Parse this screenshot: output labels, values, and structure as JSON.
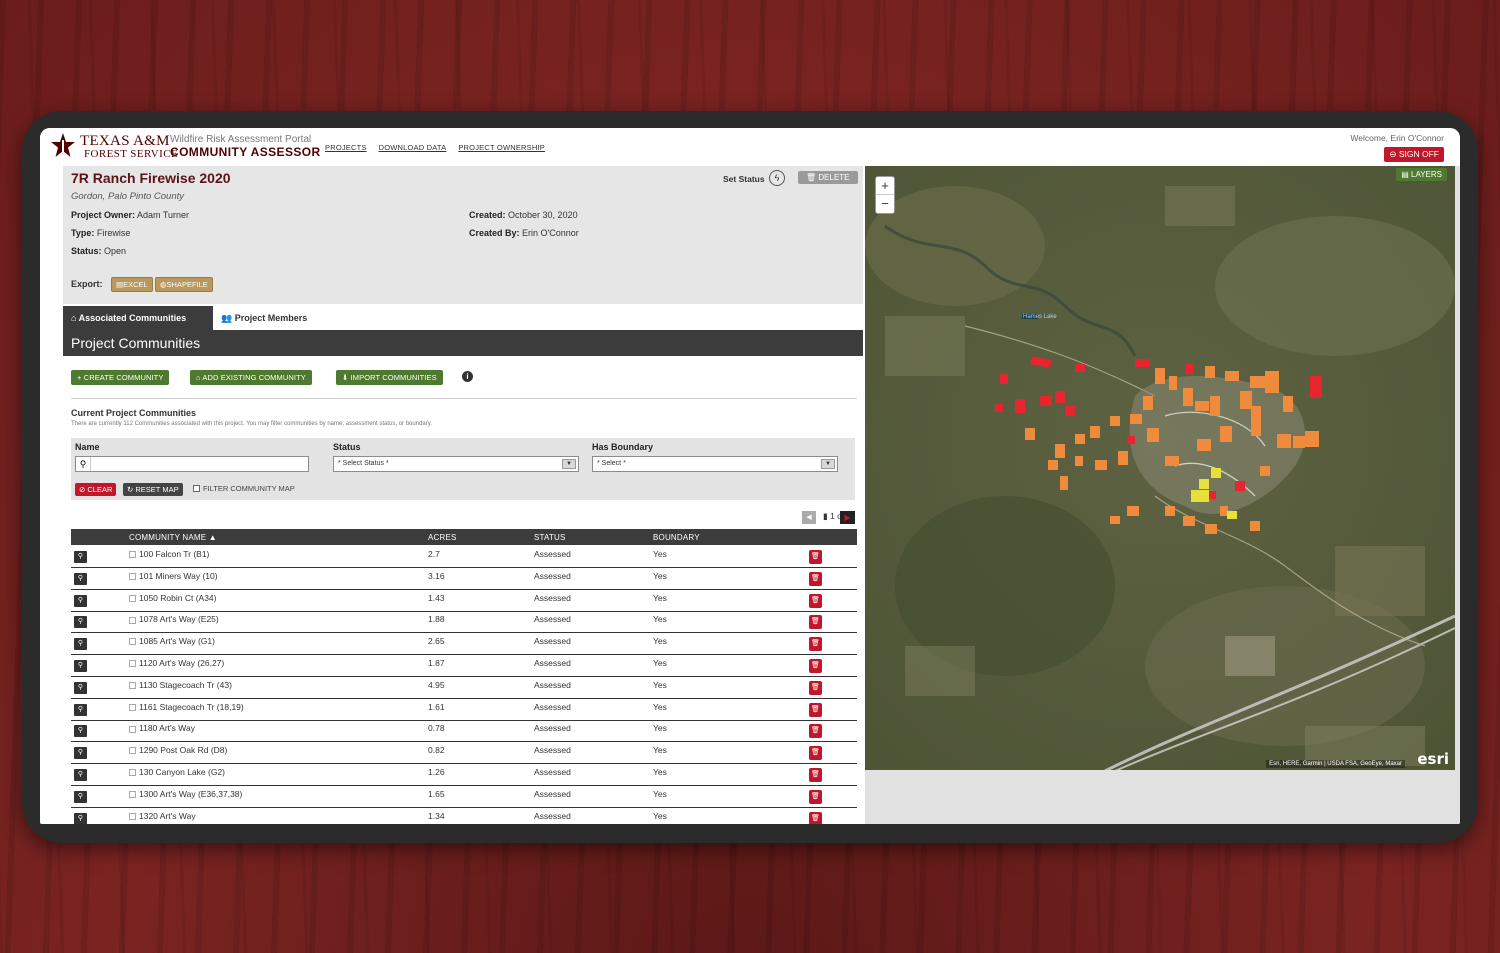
{
  "header": {
    "logo_title": "TEXAS A&M",
    "logo_sub": "FOREST SERVICE",
    "portal_sub": "Wildfire Risk Assessment Portal",
    "portal_title": "COMMUNITY ASSESSOR",
    "nav": [
      "PROJECTS",
      "DOWNLOAD DATA",
      "PROJECT OWNERSHIP"
    ],
    "welcome": "Welcome, Erin O'Connor",
    "sign_off": "SIGN OFF"
  },
  "project": {
    "title": "7R Ranch Firewise 2020",
    "location": "Gordon, Palo Pinto County",
    "owner_label": "Project Owner:",
    "owner": "Adam Turner",
    "type_label": "Type:",
    "type": "Firewise",
    "status_label": "Status:",
    "status": "Open",
    "created_label": "Created:",
    "created": "October 30, 2020",
    "created_by_label": "Created By:",
    "created_by": "Erin O'Connor",
    "set_status": "Set Status",
    "delete": "DELETE",
    "export_label": "Export:",
    "export_excel": "EXCEL",
    "export_shapefile": "SHAPEFILE"
  },
  "tabs": [
    "Associated Communities",
    "Project Members"
  ],
  "section_title": "Project Communities",
  "actions": [
    "CREATE COMMUNITY",
    "ADD EXISTING COMMUNITY",
    "IMPORT COMMUNITIES"
  ],
  "current": {
    "title": "Current Project Communities",
    "desc": "There are currently 112 Communities associated with this project. You may filter communities by name, assessment status, or boundary."
  },
  "filters": {
    "name_label": "Name",
    "name_value": "",
    "status_label": "Status",
    "status_value": "* Select Status *",
    "boundary_label": "Has Boundary",
    "boundary_value": "* Select *",
    "clear": "CLEAR",
    "reset_map": "RESET MAP",
    "filter_map": "FILTER COMMUNITY MAP"
  },
  "pager": {
    "text": "1 of 6"
  },
  "table": {
    "headers": [
      "COMMUNITY NAME",
      "ACRES",
      "STATUS",
      "BOUNDARY"
    ],
    "rows": [
      {
        "name": "100 Falcon Tr (B1)",
        "acres": "2.7",
        "status": "Assessed",
        "boundary": "Yes"
      },
      {
        "name": "101 Miners Way (10)",
        "acres": "3.16",
        "status": "Assessed",
        "boundary": "Yes"
      },
      {
        "name": "1050 Robin Ct (A34)",
        "acres": "1.43",
        "status": "Assessed",
        "boundary": "Yes"
      },
      {
        "name": "1078 Art's Way (E25)",
        "acres": "1.88",
        "status": "Assessed",
        "boundary": "Yes"
      },
      {
        "name": "1085 Art's Way (G1)",
        "acres": "2.65",
        "status": "Assessed",
        "boundary": "Yes"
      },
      {
        "name": "1120 Art's Way (26,27)",
        "acres": "1.87",
        "status": "Assessed",
        "boundary": "Yes"
      },
      {
        "name": "1130 Stagecoach Tr (43)",
        "acres": "4.95",
        "status": "Assessed",
        "boundary": "Yes"
      },
      {
        "name": "1161 Stagecoach Tr (18,19)",
        "acres": "1.61",
        "status": "Assessed",
        "boundary": "Yes"
      },
      {
        "name": "1180 Art's Way",
        "acres": "0.78",
        "status": "Assessed",
        "boundary": "Yes"
      },
      {
        "name": "1290 Post Oak Rd (D8)",
        "acres": "0.82",
        "status": "Assessed",
        "boundary": "Yes"
      },
      {
        "name": "130 Canyon Lake (G2)",
        "acres": "1.26",
        "status": "Assessed",
        "boundary": "Yes"
      },
      {
        "name": "1300 Art's Way (E36,37,38)",
        "acres": "1.65",
        "status": "Assessed",
        "boundary": "Yes"
      },
      {
        "name": "1320 Art's Way",
        "acres": "1.34",
        "status": "Assessed",
        "boundary": "Yes"
      }
    ]
  },
  "map": {
    "layers": "LAYERS",
    "lake_label": "Hames Lake",
    "attribution": "Esri, HERE, Garmin | USDA FSA, GeoEye, Maxar",
    "powered": "esri",
    "colors": {
      "high": "#e8242f",
      "medium": "#f08a3c",
      "low": "#e8e03a"
    }
  },
  "colors": {
    "brand": "#500000",
    "green": "#4d7a2f",
    "red": "#c0172b",
    "gold": "#b9985d"
  }
}
